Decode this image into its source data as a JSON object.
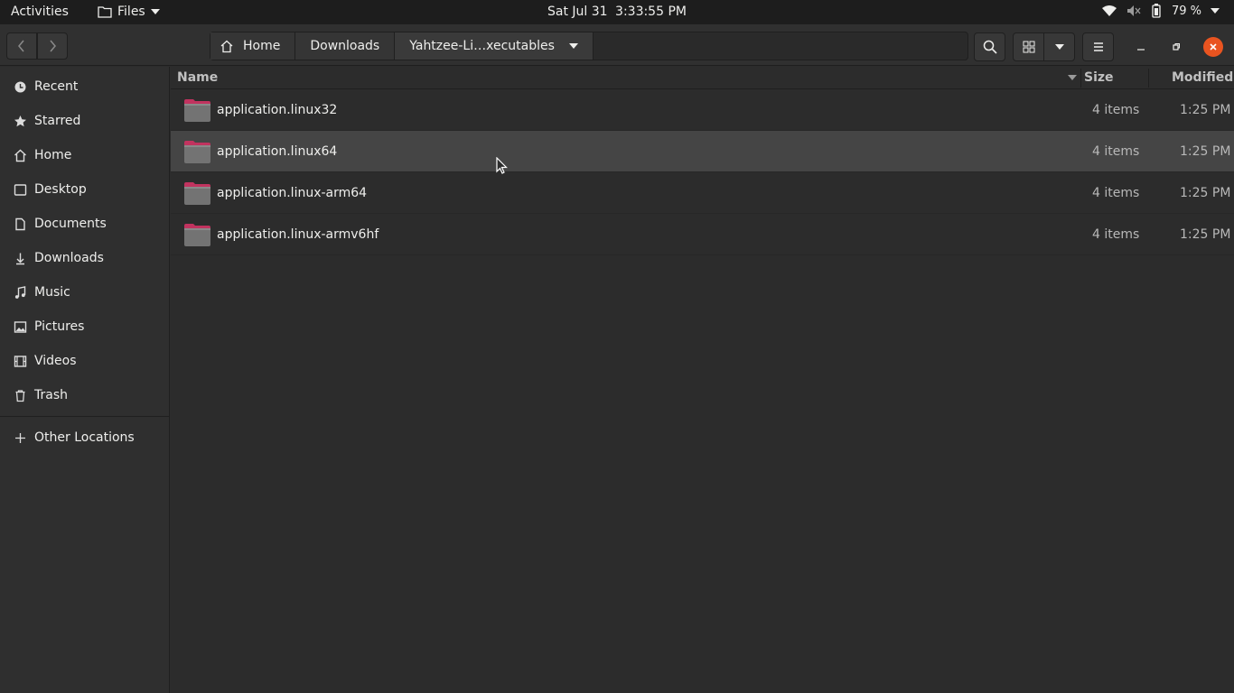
{
  "topbar": {
    "activities": "Activities",
    "app_name": "Files",
    "clock_date": "Sat Jul 31",
    "clock_time": "3:33:55 PM",
    "battery": "79 %"
  },
  "headerbar": {
    "path": [
      {
        "label": "Home",
        "icon": "home-icon"
      },
      {
        "label": "Downloads"
      },
      {
        "label": "Yahtzee-Li…xecutables"
      }
    ]
  },
  "sidebar": {
    "items": [
      {
        "label": "Recent",
        "icon": "clock-icon"
      },
      {
        "label": "Starred",
        "icon": "star-icon"
      },
      {
        "label": "Home",
        "icon": "home-icon"
      },
      {
        "label": "Desktop",
        "icon": "desktop-icon"
      },
      {
        "label": "Documents",
        "icon": "document-icon"
      },
      {
        "label": "Downloads",
        "icon": "download-icon"
      },
      {
        "label": "Music",
        "icon": "music-icon"
      },
      {
        "label": "Pictures",
        "icon": "picture-icon"
      },
      {
        "label": "Videos",
        "icon": "video-icon"
      },
      {
        "label": "Trash",
        "icon": "trash-icon"
      }
    ],
    "other_locations": "Other Locations"
  },
  "list": {
    "columns": {
      "name": "Name",
      "size": "Size",
      "modified": "Modified"
    },
    "rows": [
      {
        "name": "application.linux32",
        "size": "4 items",
        "modified": "1:25 PM"
      },
      {
        "name": "application.linux64",
        "size": "4 items",
        "modified": "1:25 PM"
      },
      {
        "name": "application.linux-arm64",
        "size": "4 items",
        "modified": "1:25 PM"
      },
      {
        "name": "application.linux-armv6hf",
        "size": "4 items",
        "modified": "1:25 PM"
      }
    ]
  },
  "colors": {
    "accent": "#e95420",
    "folder_tab": "#c1335f",
    "folder_body": "#737373"
  }
}
